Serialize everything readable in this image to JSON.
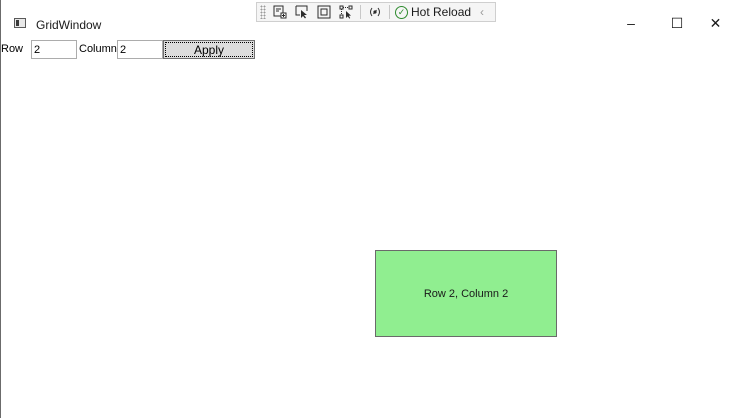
{
  "window": {
    "title": "GridWindow",
    "icon": "app-window-icon"
  },
  "devtools": {
    "icons": [
      "live-visual-tree-icon",
      "select-element-icon",
      "display-layout-adorners-icon",
      "track-focus-icon",
      "binding-failures-icon"
    ],
    "hot_reload_label": "Hot Reload",
    "collapse": "‹"
  },
  "controls": {
    "minimize": "–",
    "maximize": "☐",
    "close": "✕"
  },
  "form": {
    "row_label": "Row",
    "row_value": "2",
    "column_label": "Column",
    "column_value": "2",
    "apply_label": "Apply"
  },
  "grid": {
    "cell_text": "Row 2, Column 2",
    "cell_color": "#90ee90"
  }
}
